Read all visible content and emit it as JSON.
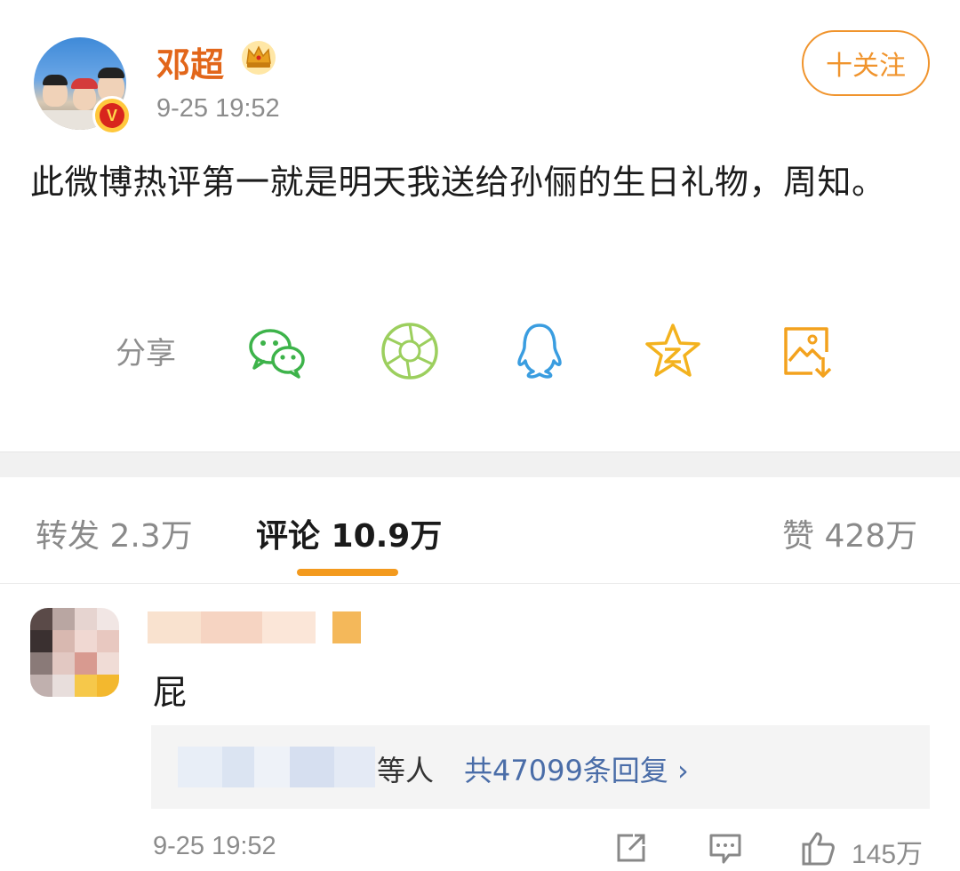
{
  "post": {
    "username": "邓超",
    "timestamp": "9-25 19:52",
    "follow_label": "十关注",
    "text": "此微博热评第一就是明天我送给孙俪的生日礼物，周知。"
  },
  "share": {
    "label": "分享",
    "icons": [
      "wechat-icon",
      "moments-icon",
      "qq-icon",
      "qzone-icon",
      "save-image-icon"
    ]
  },
  "tabs": {
    "repost": "转发 2.3万",
    "comments": "评论 10.9万",
    "likes": "赞 428万"
  },
  "comment": {
    "text": "屁",
    "reply_suffix": "等人",
    "reply_link": "共47099条回复 ›",
    "timestamp": "9-25 19:52",
    "like_count": "145万"
  },
  "colors": {
    "username": "#e2661a",
    "follow_accent": "#f0942d",
    "tab_indicator": "#f39a1e",
    "link": "#4a6da8",
    "muted": "#8c8c8c"
  }
}
